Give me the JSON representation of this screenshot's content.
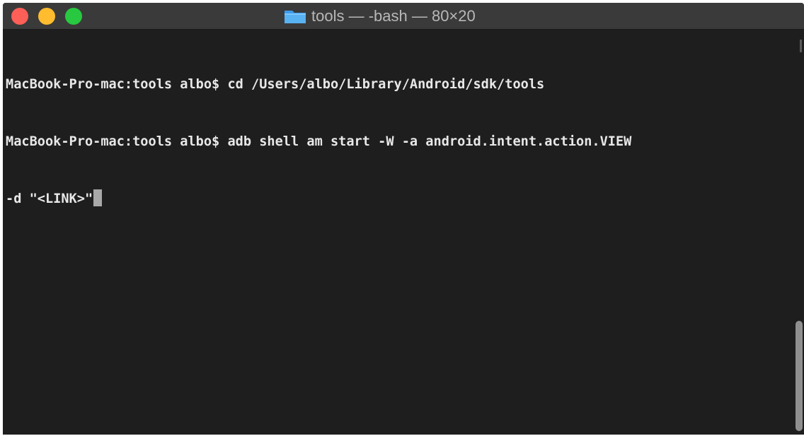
{
  "window": {
    "title": "tools — -bash — 80×20",
    "title_icon": "folder-icon",
    "buttons": [
      {
        "name": "close",
        "color": "#fe5f57"
      },
      {
        "name": "minimize",
        "color": "#febc2e"
      },
      {
        "name": "zoom",
        "color": "#28c840"
      }
    ]
  },
  "terminal": {
    "background": "#1e1e1e",
    "text_color": "#e8e8e8",
    "lines": [
      "MacBook-Pro-mac:tools albo$ cd /Users/albo/Library/Android/sdk/tools",
      "MacBook-Pro-mac:tools albo$ adb shell am start -W -a android.intent.action.VIEW",
      "-d \"<LINK>\""
    ],
    "cursor": "block-cursor"
  },
  "scrollbar": {
    "thumb_color": "#8f8f8f"
  }
}
